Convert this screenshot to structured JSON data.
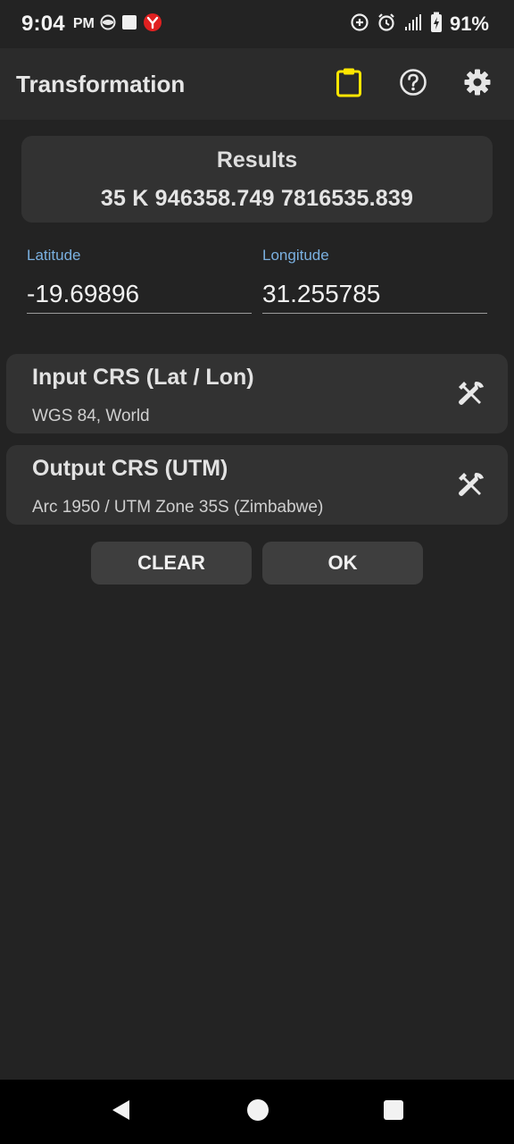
{
  "status_bar": {
    "time": "9:04",
    "ampm": "PM",
    "battery": "91%"
  },
  "app_bar": {
    "title": "Transformation",
    "icons": [
      "clipboard-icon",
      "help-icon",
      "settings-icon"
    ],
    "accent": "#ffe600"
  },
  "results": {
    "title": "Results",
    "value": "35 K 946358.749 7816535.839"
  },
  "latitude": {
    "label": "Latitude",
    "value": "-19.69896"
  },
  "longitude": {
    "label": "Longitude",
    "value": "31.255785"
  },
  "input_crs": {
    "title": "Input CRS  (Lat / Lon)",
    "subtitle": "WGS 84, World"
  },
  "output_crs": {
    "title": "Output CRS  (UTM)",
    "subtitle": "Arc 1950 / UTM Zone 35S (Zimbabwe)"
  },
  "buttons": {
    "clear": "CLEAR",
    "ok": "OK"
  },
  "colors": {
    "background": "#232323",
    "card": "#323232",
    "label_blue": "#7ab0e0",
    "clipboard_yellow": "#ffe600",
    "notification_red": "#e02020"
  }
}
